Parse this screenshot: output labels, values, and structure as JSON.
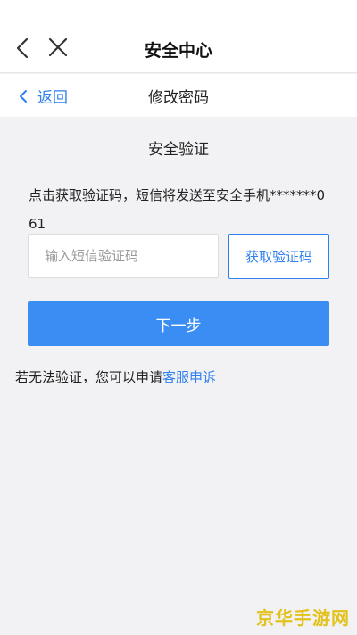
{
  "header": {
    "title": "安全中心",
    "back_icon": "chevron-left-icon",
    "close_icon": "close-icon"
  },
  "subheader": {
    "back_label": "返回",
    "title": "修改密码"
  },
  "verify": {
    "section_title": "安全验证",
    "info_text": "点击获取验证码，短信将发送至安全手机*******061",
    "code_input": {
      "placeholder": "输入短信验证码",
      "value": ""
    },
    "get_code_label": "获取验证码",
    "next_label": "下一步",
    "appeal_prefix": "若无法验证，您可以申请",
    "appeal_link": "客服申诉"
  },
  "watermark": "京华手游网",
  "colors": {
    "accent": "#2f80ed",
    "primary_button": "#3a8ef3",
    "background": "#f2f2f4",
    "watermark": "#e3c21e"
  }
}
